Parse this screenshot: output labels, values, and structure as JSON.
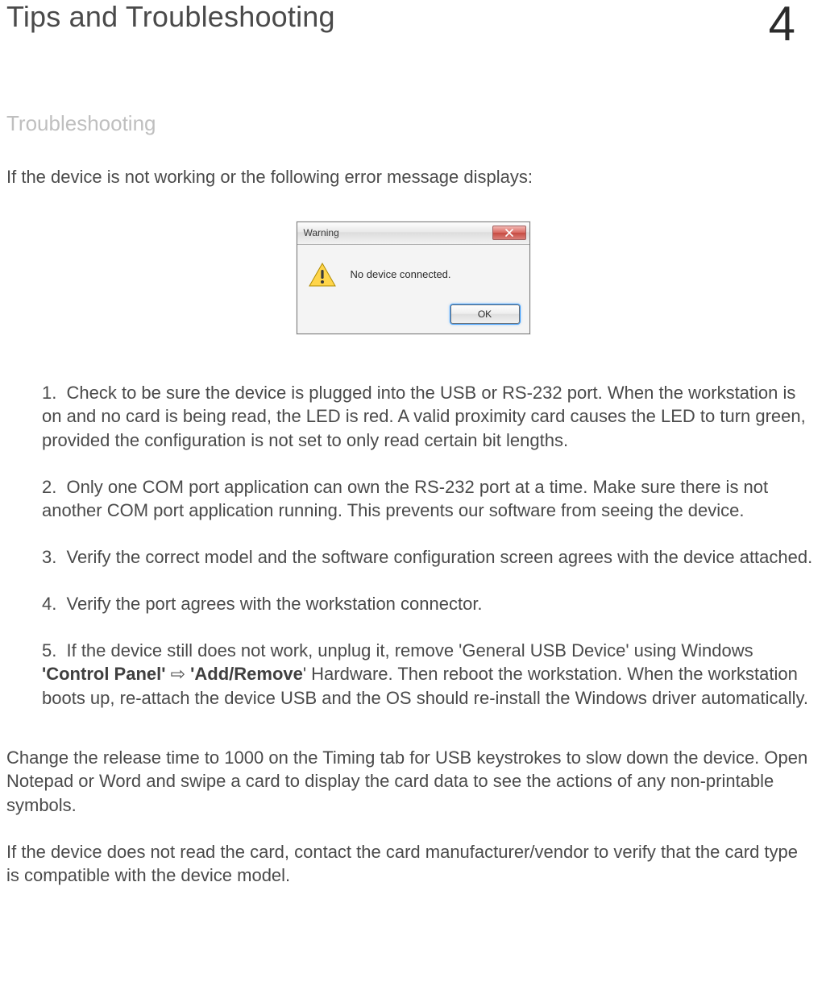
{
  "header": {
    "title": "Tips and Troubleshooting",
    "chapter": "4"
  },
  "section_heading": "Troubleshooting",
  "intro": "If the device is not working or the following error message displays:",
  "dialog": {
    "title": "Warning",
    "message": "No device connected.",
    "ok_label": "OK"
  },
  "steps": {
    "s1_num": "1.",
    "s1": "Check to be sure the device is plugged into the USB or RS-232 port. When the workstation is on and no card is being read, the LED is red. A valid proximity card causes the LED to turn green, provided the configuration is not set to only read certain bit lengths.",
    "s2_num": "2.",
    "s2": "Only one COM port application can own the RS-232 port at a time. Make sure there is not another COM port application running. This prevents our software from seeing the device.",
    "s3_num": "3.",
    "s3": "Verify the correct model and the software configuration screen agrees with the device attached.",
    "s4_num": "4.",
    "s4": "Verify the port agrees with the workstation connector.",
    "s5_num": "5.",
    "s5_a": "If the device still does not work, unplug it, remove 'General USB Device' using Windows ",
    "s5_b1": "'Control Panel'",
    "s5_arrow": " ⇨ ",
    "s5_b2": "'Add/Remove",
    "s5_c": "' Hardware. Then reboot the workstation. When the workstation boots up, re-attach the device USB and the OS should re-install the Windows driver automatically."
  },
  "tail": {
    "p1": "Change the release time to 1000 on the Timing tab for USB keystrokes to slow down the device. Open Notepad or Word and swipe a card to display the card data to see the actions of any non-printable symbols.",
    "p2": "If the device does not read the card, contact the card manufacturer/vendor to verify that the card type is compatible with the device model."
  }
}
